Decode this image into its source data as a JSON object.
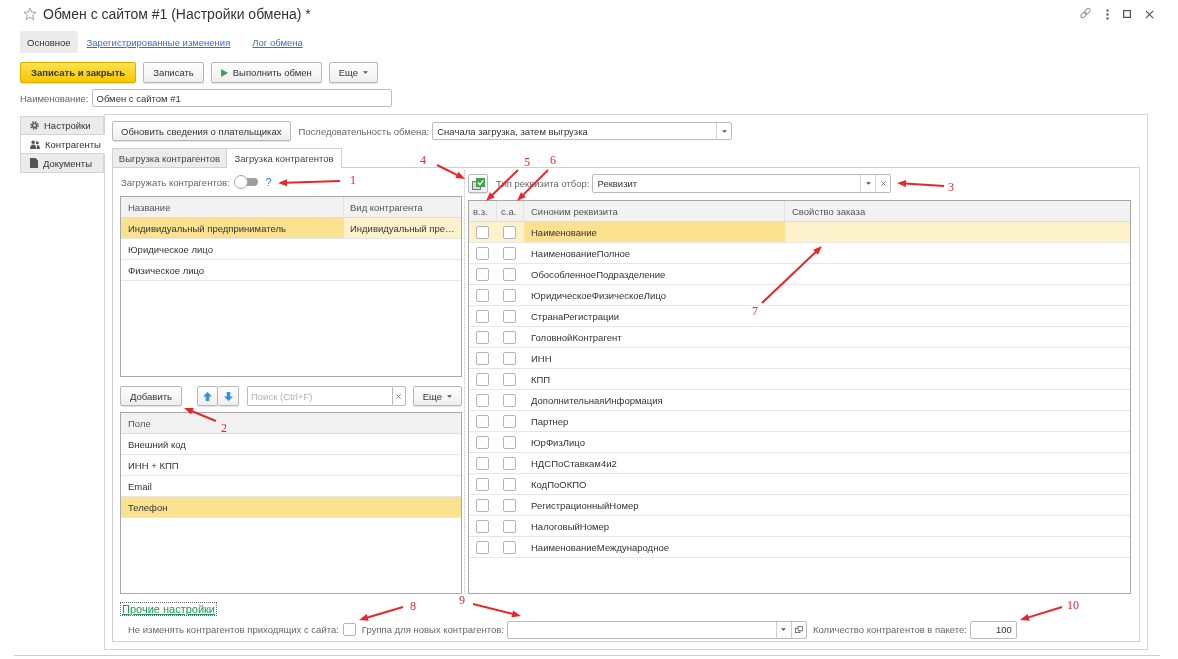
{
  "window": {
    "title": "Обмен с сайтом #1 (Настройки обмена) *"
  },
  "header_tabs": [
    {
      "label": "Основное",
      "selected": true
    },
    {
      "label": "Зарегистрированные изменения",
      "selected": false
    },
    {
      "label": "Лог обмена",
      "selected": false
    }
  ],
  "toolbar": {
    "buttons": [
      {
        "label": "Записать и закрыть",
        "kind": "primary"
      },
      {
        "label": "Записать",
        "kind": "plain"
      },
      {
        "label": "Выполнить обмен",
        "kind": "run"
      }
    ],
    "more": "Еще"
  },
  "name_field": {
    "label": "Наименование:",
    "value": "Обмен с сайтом #1"
  },
  "side_tabs": [
    {
      "label": "Настройки",
      "kind": "gear",
      "selected": false
    },
    {
      "label": "Контрагенты",
      "kind": "people",
      "selected": true
    },
    {
      "label": "Документы",
      "kind": "document",
      "selected": false
    }
  ],
  "panel": {
    "refresh_button": "Обновить сведения о плательщиках",
    "sequence": {
      "label": "Последовательность обмена:",
      "value": "Сначала загрузка, затем выгрузка"
    },
    "subtabs": [
      {
        "label": "Выгрузка контрагентов",
        "selected": false
      },
      {
        "label": "Загрузка контрагентов",
        "selected": true
      }
    ]
  },
  "load_toggle": {
    "label": "Загружать контрагентов:",
    "on": false,
    "help": "?"
  },
  "types_table": {
    "columns": [
      "Название",
      "Вид контрагента"
    ],
    "rows": [
      {
        "cells": [
          "Индивидуальный предприниматель",
          "Индивидуальный пре…"
        ],
        "selected": true
      },
      {
        "cells": [
          "Юридическое лицо"
        ],
        "selected": false
      },
      {
        "cells": [
          "Физическое лицо"
        ],
        "selected": false
      }
    ]
  },
  "fields_toolbar": {
    "add_button": "Добавить",
    "search": {
      "placeholder": "Поиск (Ctrl+F)"
    },
    "more": "Еще"
  },
  "fields_table": {
    "columns": [
      "Поле"
    ],
    "rows": [
      {
        "value": "Внешний код",
        "selected": false
      },
      {
        "value": "ИНН + КПП",
        "selected": false
      },
      {
        "value": "Email",
        "selected": false
      },
      {
        "value": "Телефон",
        "selected": true
      }
    ]
  },
  "attribute_filter": {
    "label": "Тип реквизита отбор:",
    "value": "Реквизит"
  },
  "attributes_table": {
    "columns": [
      "в.з.",
      "с.а.",
      "Синоним реквизита",
      "Свойство заказа"
    ],
    "rows": [
      {
        "vz": false,
        "sa": false,
        "synonym": "Наименование",
        "selected": true
      },
      {
        "vz": false,
        "sa": false,
        "synonym": "НаименованиеПолное",
        "selected": false
      },
      {
        "vz": false,
        "sa": false,
        "synonym": "ОбособленноеПодразделение",
        "selected": false
      },
      {
        "vz": false,
        "sa": false,
        "synonym": "ЮридическоеФизическоеЛицо",
        "selected": false
      },
      {
        "vz": false,
        "sa": false,
        "synonym": "СтранаРегистрации",
        "selected": false
      },
      {
        "vz": false,
        "sa": false,
        "synonym": "ГоловнойКонтрагент",
        "selected": false
      },
      {
        "vz": false,
        "sa": false,
        "synonym": "ИНН",
        "selected": false
      },
      {
        "vz": false,
        "sa": false,
        "synonym": "КПП",
        "selected": false
      },
      {
        "vz": false,
        "sa": false,
        "synonym": "ДополнительнаяИнформация",
        "selected": false
      },
      {
        "vz": false,
        "sa": false,
        "synonym": "Партнер",
        "selected": false
      },
      {
        "vz": false,
        "sa": false,
        "synonym": "ЮрФизЛицо",
        "selected": false
      },
      {
        "vz": false,
        "sa": false,
        "synonym": "НДСПоСтавкам4и2",
        "selected": false
      },
      {
        "vz": false,
        "sa": false,
        "synonym": "КодПоОКПО",
        "selected": false
      },
      {
        "vz": false,
        "sa": false,
        "synonym": "РегистрационныйНомер",
        "selected": false
      },
      {
        "vz": false,
        "sa": false,
        "synonym": "НалоговыйНомер",
        "selected": false
      },
      {
        "vz": false,
        "sa": false,
        "synonym": "НаименованиеМеждународное",
        "selected": false
      }
    ]
  },
  "other_settings": {
    "link": "Прочие настройки",
    "keep_incoming": {
      "label": "Не изменять контрагентов приходящих с сайта:",
      "checked": false
    },
    "new_group": {
      "label": "Группа для новых контрагентов:"
    },
    "batch_size": {
      "label": "Количество контрагентов в пакете:",
      "value": "100"
    }
  },
  "annotations": [
    {
      "label": "1"
    },
    {
      "label": "2"
    },
    {
      "label": "3"
    },
    {
      "label": "4"
    },
    {
      "label": "5"
    },
    {
      "label": "6"
    },
    {
      "label": "7"
    },
    {
      "label": "8"
    },
    {
      "label": "9"
    },
    {
      "label": "10"
    }
  ]
}
